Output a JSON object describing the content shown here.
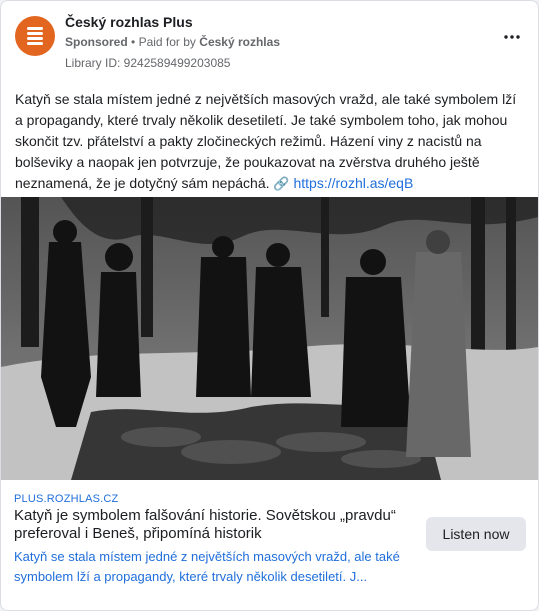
{
  "header": {
    "page_name": "Český rozhlas Plus",
    "sponsored": "Sponsored",
    "separator": "•",
    "paid_for_by": "Paid for by",
    "payer": "Český rozhlas",
    "library_id": "Library ID: 9242589499203085",
    "avatar_color": "#e2661f",
    "more_icon": "more-horizontal-icon"
  },
  "post": {
    "text": "Katyň se stala místem jedné z největších masových vražd, ale také symbolem lží a propagandy, které trvaly několik desetiletí. Je také symbolem toho, jak mohou skončit tzv. přátelství a pakty zločineckých režimů. Házení viny z nacistů na bolševiky a naopak jen potvrzuje, že poukazovat na zvěrstva druhého ještě neznamená, že je dotyčný sám nepáchá.",
    "link_icon": "🔗",
    "link_text": "https://rozhl.as/eqB"
  },
  "link_preview": {
    "domain": "PLUS.ROZHLAS.CZ",
    "headline": "Katyň je symbolem falšování historie. Sovětskou „pravdu“ preferoval i Beneš, připomíná historik",
    "description": "Katyň se stala místem jedné z největších masových vražd, ale také symbolem lží a propagandy, které trvaly několik desetiletí. J...",
    "cta": "Listen now"
  },
  "colors": {
    "link_blue": "#216fdb",
    "meta_gray": "#65676b",
    "button_bg": "#e4e6eb"
  }
}
